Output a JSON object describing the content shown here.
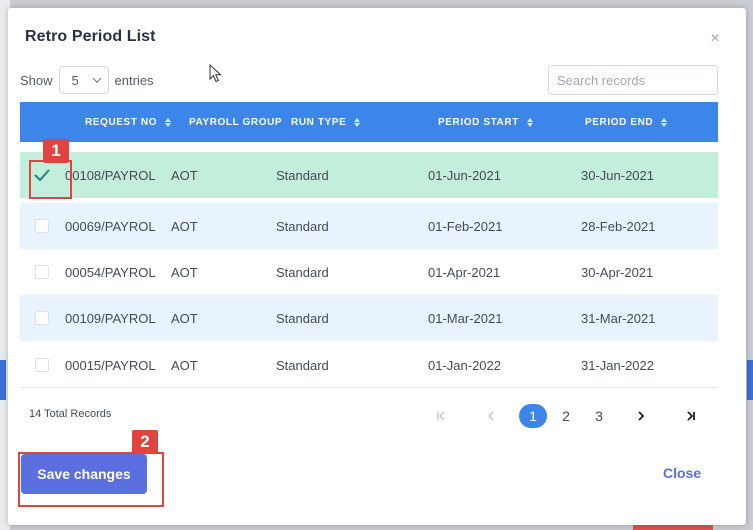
{
  "modal": {
    "title": "Retro Period List",
    "close_glyph": "×"
  },
  "controls": {
    "show_label": "Show",
    "entries_value": "5",
    "entries_label": "entries",
    "search_placeholder": "Search records"
  },
  "table": {
    "columns": [
      "REQUEST NO",
      "PAYROLL GROUP",
      "RUN TYPE",
      "PERIOD START",
      "PERIOD END"
    ],
    "rows": [
      {
        "checked": true,
        "request_no": "00108/PAYROL",
        "payroll_group": "AOT",
        "run_type": "Standard",
        "period_start": "01-Jun-2021",
        "period_end": "30-Jun-2021"
      },
      {
        "checked": false,
        "request_no": "00069/PAYROL",
        "payroll_group": "AOT",
        "run_type": "Standard",
        "period_start": "01-Feb-2021",
        "period_end": "28-Feb-2021"
      },
      {
        "checked": false,
        "request_no": "00054/PAYROL",
        "payroll_group": "AOT",
        "run_type": "Standard",
        "period_start": "01-Apr-2021",
        "period_end": "30-Apr-2021"
      },
      {
        "checked": false,
        "request_no": "00109/PAYROL",
        "payroll_group": "AOT",
        "run_type": "Standard",
        "period_start": "01-Mar-2021",
        "period_end": "31-Mar-2021"
      },
      {
        "checked": false,
        "request_no": "00015/PAYROL",
        "payroll_group": "AOT",
        "run_type": "Standard",
        "period_start": "01-Jan-2022",
        "period_end": "31-Jan-2022"
      }
    ]
  },
  "footer": {
    "total_records": "14 Total Records",
    "pages": [
      "1",
      "2",
      "3"
    ],
    "current_page": "1",
    "save_label": "Save changes",
    "close_label": "Close"
  },
  "annotations": {
    "step1": "1",
    "step2": "2"
  },
  "colors": {
    "header_blue": "#3b86e8",
    "selected_row": "#c3eedb",
    "stripe_row": "#e8f3fd",
    "callout_red": "#e0443e",
    "primary_button": "#5b6fe0"
  }
}
